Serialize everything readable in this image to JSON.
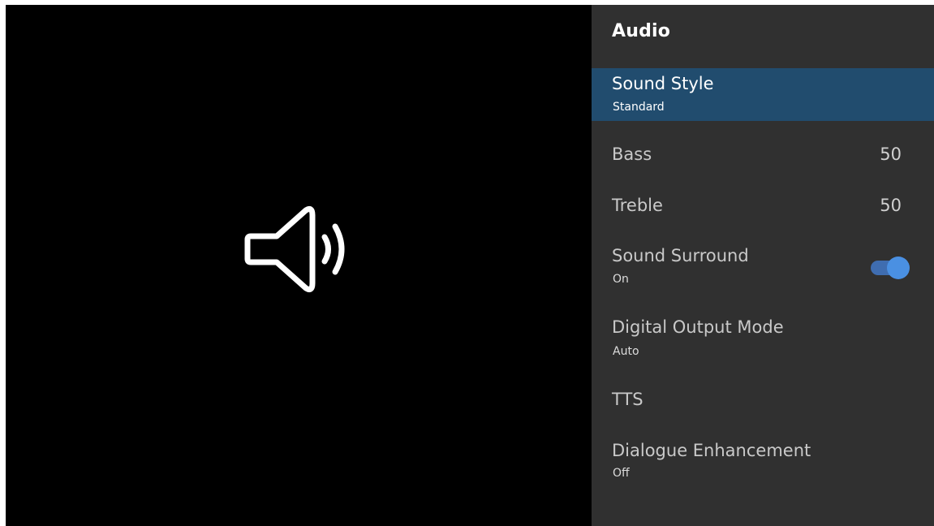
{
  "preview": {
    "icon": "speaker-volume-icon"
  },
  "panel": {
    "title": "Audio",
    "items": [
      {
        "label": "Sound Style",
        "subtitle": "Standard",
        "selected": true
      },
      {
        "label": "Bass",
        "value": "50"
      },
      {
        "label": "Treble",
        "value": "50"
      },
      {
        "label": "Sound Surround",
        "subtitle": "On",
        "toggle": true
      },
      {
        "label": "Digital Output Mode",
        "subtitle": "Auto"
      },
      {
        "label": "TTS"
      },
      {
        "label": "Dialogue Enhancement",
        "subtitle": "Off"
      }
    ]
  },
  "colors": {
    "panel_bg": "#303030",
    "selected_bg": "#214c6e",
    "toggle_on": "#4a90e2"
  }
}
